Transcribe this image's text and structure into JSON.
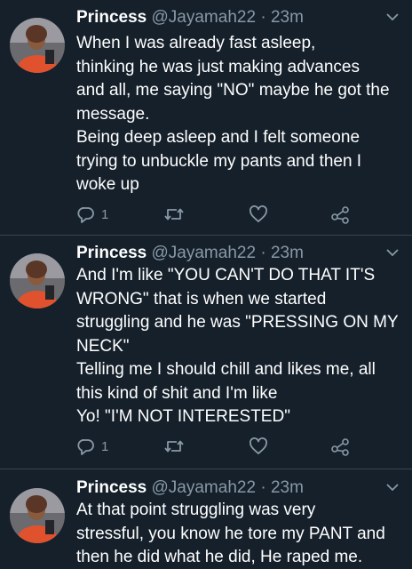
{
  "tweets": [
    {
      "author_name": "Princess",
      "handle": "@Jayamah22",
      "separator": "·",
      "time": "23m",
      "text": "When I was already fast asleep,\nthinking he was just making advances\nand all, me saying \"NO\" maybe he got the\nmessage.\nBeing deep asleep and I felt someone\ntrying to unbuckle my pants and then I\nwoke up",
      "reply_count": "1",
      "icons": [
        "reply-icon",
        "retweet-icon",
        "like-icon",
        "share-icon"
      ]
    },
    {
      "author_name": "Princess",
      "handle": "@Jayamah22",
      "separator": "·",
      "time": "23m",
      "text": "And I'm like \"YOU CAN'T DO THAT IT'S\nWRONG\" that is when we started\nstruggling and he was \"PRESSING ON MY\nNECK\"\n Telling me I should chill and likes me, all\nthis kind of shit and I'm like\nYo! \"I'M NOT INTERESTED\"",
      "reply_count": "1",
      "icons": [
        "reply-icon",
        "retweet-icon",
        "like-icon",
        "share-icon"
      ]
    },
    {
      "author_name": "Princess",
      "handle": "@Jayamah22",
      "separator": "·",
      "time": "23m",
      "text": "At that point struggling was very\nstressful, you know he tore my PANT  and\nthen he did what he did, He raped me.",
      "icons": [
        "reply-icon",
        "retweet-icon",
        "like-icon",
        "share-icon"
      ]
    }
  ],
  "colors": {
    "background": "#15202b",
    "text_primary": "#ffffff",
    "text_secondary": "#8899a6",
    "divider": "#38444d"
  }
}
